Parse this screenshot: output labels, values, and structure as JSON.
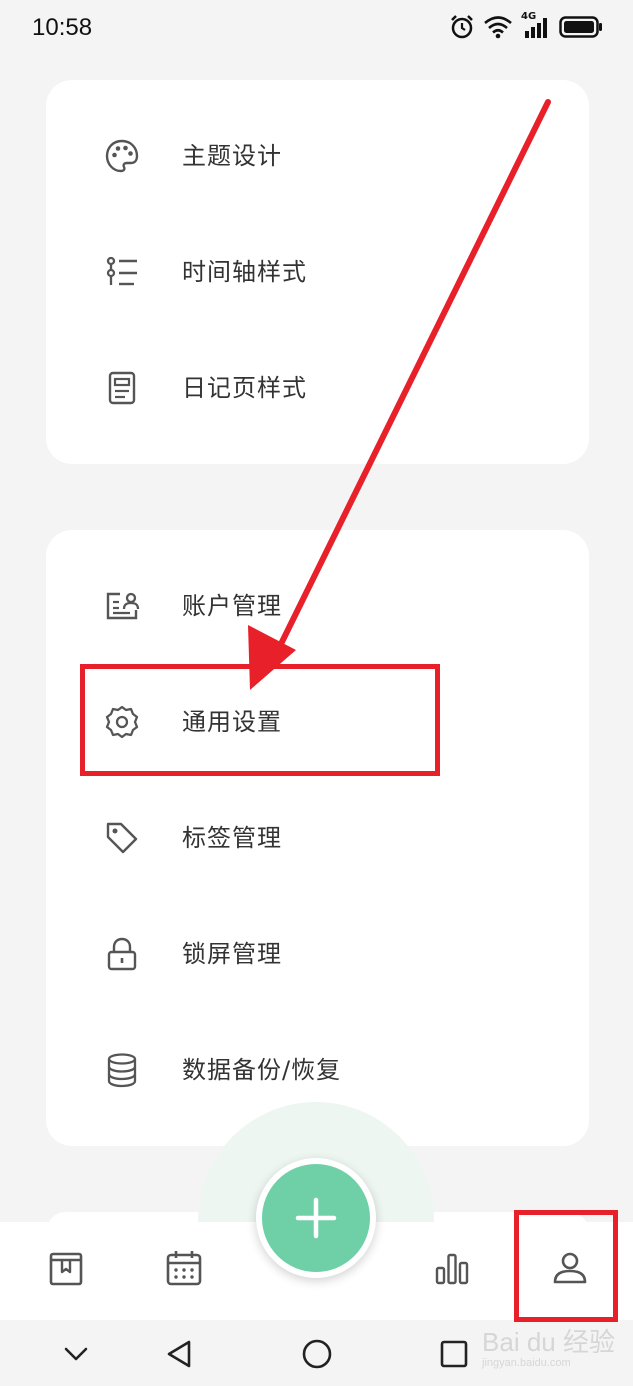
{
  "status_bar": {
    "time": "10:58",
    "network": "4G"
  },
  "personalization": {
    "items": [
      {
        "label": "主题设计",
        "icon": "palette-icon"
      },
      {
        "label": "时间轴样式",
        "icon": "timeline-icon"
      },
      {
        "label": "日记页样式",
        "icon": "diary-page-icon"
      }
    ]
  },
  "management": {
    "items": [
      {
        "label": "账户管理",
        "icon": "account-card-icon"
      },
      {
        "label": "通用设置",
        "icon": "gear-icon"
      },
      {
        "label": "标签管理",
        "icon": "tag-icon"
      },
      {
        "label": "锁屏管理",
        "icon": "lock-icon"
      },
      {
        "label": "数据备份/恢复",
        "icon": "database-icon"
      }
    ]
  },
  "bottom_nav": {
    "items": [
      {
        "icon": "diary-book-icon"
      },
      {
        "icon": "calendar-icon"
      },
      {
        "icon": "add-icon"
      },
      {
        "icon": "bar-chart-icon"
      },
      {
        "icon": "profile-icon"
      }
    ]
  },
  "watermark": {
    "brand": "Bai du 经验",
    "url": "jingyan.baidu.com"
  },
  "colors": {
    "accent_green": "#6fd0a8",
    "annotation_red": "#e8202a",
    "card_bg": "#ffffff",
    "page_bg": "#f4f4f4",
    "icon_gray": "#555555"
  }
}
